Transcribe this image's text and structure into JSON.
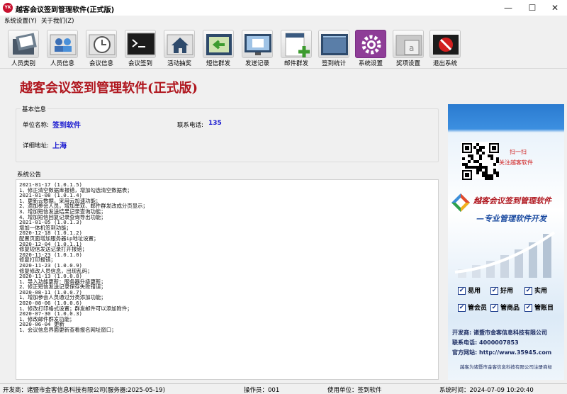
{
  "window": {
    "icon_text": "YK",
    "title": "越客会议签到管理软件(正式版)",
    "minimize": "—",
    "maximize": "☐",
    "close": "✕"
  },
  "menu": [
    "系统设置(Y)",
    "关于我们(Z)"
  ],
  "toolbar": [
    {
      "label": "人员类别",
      "icon": "folder-picture-icon"
    },
    {
      "label": "人员信息",
      "icon": "users-icon"
    },
    {
      "label": "会议信息",
      "icon": "history-clock-icon"
    },
    {
      "label": "会议签到",
      "icon": "terminal-icon"
    },
    {
      "label": "活动抽奖",
      "icon": "home-icon"
    },
    {
      "label": "短信群发",
      "icon": "arrow-message-icon"
    },
    {
      "label": "发送记录",
      "icon": "monitor-icon"
    },
    {
      "label": "邮件群发",
      "icon": "add-document-icon"
    },
    {
      "label": "签到统计",
      "icon": "window-icon"
    },
    {
      "label": "系统设置",
      "icon": "gear-icon"
    },
    {
      "label": "奖项设置",
      "icon": "award-folder-icon"
    },
    {
      "label": "退出系统",
      "icon": "exit-icon"
    }
  ],
  "banner": "越客会议签到管理软件(正式版)",
  "basic_info": {
    "title": "基本信息",
    "unit_label": "单位名称:",
    "unit_value": "签到软件",
    "phone_label": "联系电话:",
    "phone_value": "135",
    "address_label": "详细地址:",
    "address_value": "上海"
  },
  "notice": {
    "title": "系统公告",
    "lines": [
      "2021-01-17 (1.0.1.5)",
      "1、修正清空数据库报错，增加勾选清空数据表；",
      "2021-01-08 (1.0.1.4)",
      "1、更新云数据，采用云加速功能；",
      "2、添加参会人员，增加单双、邮件群发改成分页显示；",
      "3、增加短信发送结果记录查询功能；",
      "4、增加短信回复记录查询导出功能；",
      "2021-01-05 (1.0.1.3)",
      "增加一体机签到功能；",
      "2020-12-18 (1.0.1.2)",
      "配置页面增加服务器ip地址设置；",
      "2020-12-04 (1.0.1.1)",
      "修复短信发送记录打开报错；",
      "2020-11-23 (1.0.1.0)",
      "修复打印报错；",
      "2020-11-23 (1.0.0.9)",
      "修复修改人员信息，出现乱码；",
      "2020-11-13 (1.0.0.8)",
      "1、导入功能更新：服务器升级更新；",
      "2、修正短信发送记录保存失败错误；",
      "2020-08-11 (1.0.0.7)",
      "1、增加参会人员通过分类添加功能；",
      "2020-08-06 (1.0.0.6)",
      "1、修改打印格式设置；群发邮件可以添加附件；",
      "2020-07-30 (1.0.0.3)",
      "1、修改邮件群发功能；",
      "2020-06-04 更新",
      "1、会议信息界面更新查看报名网址窗口；"
    ]
  },
  "ad": {
    "scan": "扫一扫",
    "follow": "关注越客软件",
    "brand": "越客会议签到管理软件",
    "slogan": "—专业管理软件开发",
    "checks": [
      "易用",
      "好用",
      "实用",
      "管会员",
      "管商品",
      "管账目"
    ],
    "dev_label": "开发商:",
    "dev_value": "诸暨市金客信息科技有限公司",
    "phone_label": "联系电话:",
    "phone_value": "4000007853",
    "site_label": "官方网站:",
    "site_value": "http://www.35945.com",
    "footer": "越客为诸暨市金客信息科技有限公司注册商标"
  },
  "status": {
    "developer": "开发商：诸暨市金客信息科技有限公司(服务器:2025-05-19)",
    "operator": "操作员：001",
    "unit": "使用单位：签到软件",
    "time": "系统时间：2024-07-09 10:20:40"
  },
  "colors": {
    "banner_red": "#b0171f",
    "value_blue": "#1a1ad0",
    "ad_blue": "#2b7bd0"
  }
}
